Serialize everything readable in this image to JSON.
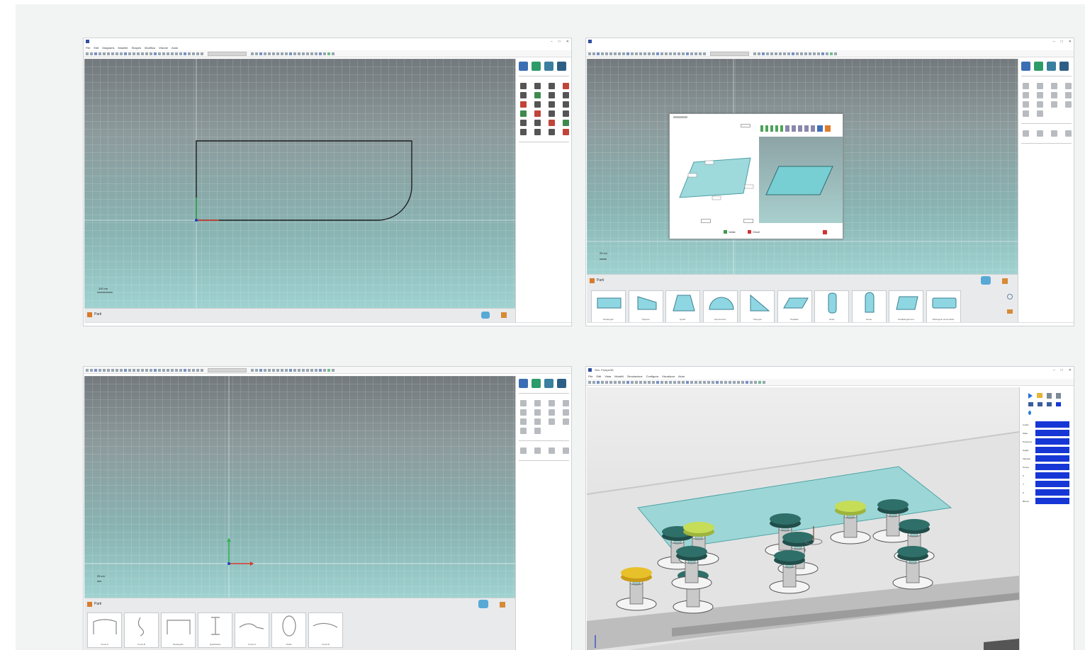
{
  "screenshots": {
    "sketch": {
      "menu": [
        "File",
        "Edit",
        "Diagrams",
        "Modelle",
        "Shapes",
        "Modifica",
        "Visione",
        "Aiuto"
      ],
      "scale": "100 cm",
      "parts_label": "Parti"
    },
    "shapes_dialog": {
      "scale": "25 cm",
      "parts_label": "Parti",
      "shapes": [
        "Rettangolo",
        "Trapezio",
        "Quadr.",
        "Semicerchio",
        "Triangolo",
        "Parallelo",
        "Ovale",
        "Scudo",
        "Parallelogramma",
        "Rettangolo arrotondato"
      ],
      "dialog": {
        "ok_label": "Valida",
        "cancel_label": "Chiudi"
      }
    },
    "blank_sketch": {
      "scale": "25 cm",
      "parts_label": "Parti",
      "curves": [
        "Curva A",
        "Curva B",
        "Rettangolo",
        "Quadratura",
        "Curva C",
        "Ovale",
        "Curva D"
      ]
    },
    "simulation": {
      "title": "Sim. Pompe3D",
      "menu": [
        "File",
        "Edit",
        "Vista",
        "Modelli",
        "Simulazione",
        "Configura",
        "Visualizza",
        "Aiuto"
      ],
      "properties": [
        "Livello",
        "Stato",
        "Pressione",
        "Soglia",
        "Velocità",
        "Tempo",
        "X",
        "Y",
        "Z",
        "Blocco"
      ]
    }
  }
}
